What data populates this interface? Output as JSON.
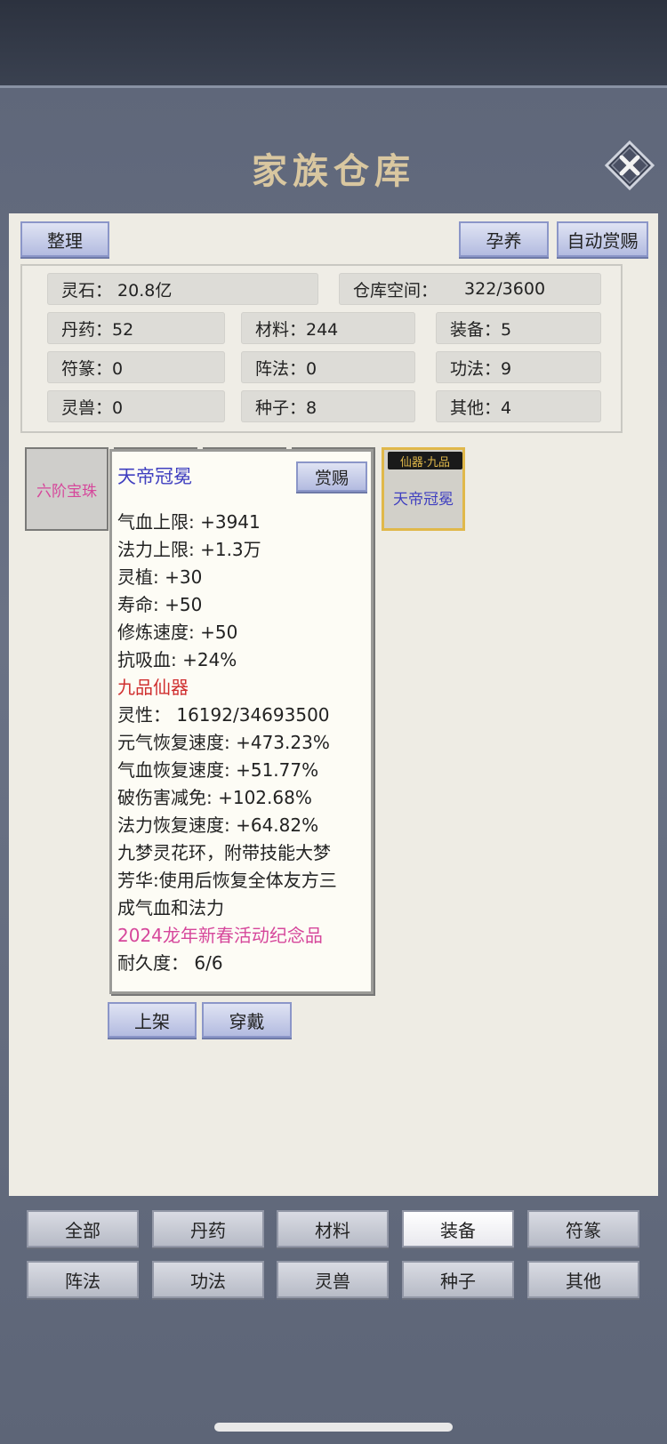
{
  "title": "家族仓库",
  "toolbar": {
    "sort_label": "整理",
    "nurture_label": "孕养",
    "auto_reward_label": "自动赏赐"
  },
  "stats": {
    "spirit_stone": "灵石：  20.8亿",
    "storage_space_label": "仓库空间：",
    "storage_space_value": "322/3600",
    "pills": "丹药：52",
    "materials": "材料：244",
    "equipment": "装备：5",
    "talismans": "符篆：0",
    "formations": "阵法：0",
    "techniques": "功法：9",
    "beasts": "灵兽：0",
    "seeds": "种子：8",
    "others": "其他：4"
  },
  "items": [
    {
      "name": "六阶宝珠",
      "color": "#d6479b"
    },
    {
      "name": "天帝冠冕",
      "badge": "仙器·九品",
      "color": "#4040c0"
    }
  ],
  "tooltip": {
    "name": "天帝冠冕",
    "reward_label": "赏赐",
    "lines": [
      "气血上限: +3941",
      "法力上限: +1.3万",
      "灵植: +30",
      "寿命: +50",
      "修炼速度: +50",
      "抗吸血: +24%"
    ],
    "grade": "九品仙器",
    "spirit": "灵性：  16192/34693500",
    "bonus_lines": [
      "元气恢复速度: +473.23%",
      "气血恢复速度: +51.77%",
      "破伤害减免: +102.68%",
      "法力恢复速度: +64.82%"
    ],
    "desc_lines": [
      "九梦灵花环，附带技能大梦",
      "芳华:使用后恢复全体友方三",
      "成气血和法力"
    ],
    "event": "2024龙年新春活动纪念品",
    "durability": "耐久度：  6/6"
  },
  "actions": {
    "list_label": "上架",
    "wear_label": "穿戴"
  },
  "tabs": [
    "全部",
    "丹药",
    "材料",
    "装备",
    "符篆",
    "阵法",
    "功法",
    "灵兽",
    "种子",
    "其他"
  ],
  "active_tab": "装备",
  "colors": {
    "title_gold": "#d9c7a0",
    "item_name_blue": "#4040c0",
    "grade_red": "#d03030",
    "event_pink": "#d6479b",
    "badge_gold": "#e0b84a"
  }
}
